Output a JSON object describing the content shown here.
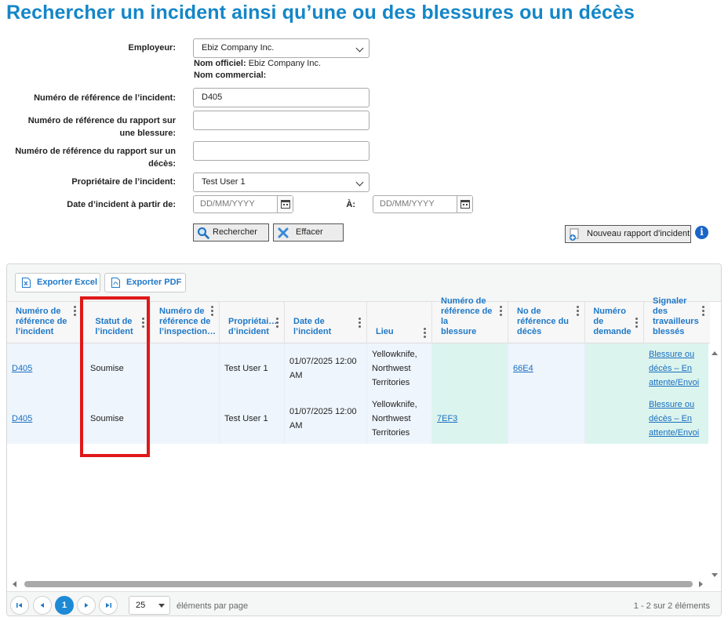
{
  "page": {
    "title": "Rechercher un incident ainsi qu’une ou des blessures ou un décès"
  },
  "form": {
    "employer": {
      "label": "Employeur:",
      "value": "Ebiz Company Inc.",
      "official_name_label": "Nom officiel:",
      "official_name": "Ebiz Company Inc.",
      "commercial_name_label": "Nom commercial:"
    },
    "incident_ref": {
      "label": "Numéro de référence de l’incident:",
      "value": "D405"
    },
    "injury_report_ref": {
      "label_line1": "Numéro de référence du rapport sur",
      "label_line2": "une blessure:",
      "value": ""
    },
    "death_report_ref": {
      "label_line1": "Numéro de référence du rapport sur un",
      "label_line2": "décès:",
      "value": ""
    },
    "owner": {
      "label": "Propriétaire de l’incident:",
      "value": "Test User 1"
    },
    "date_from": {
      "label": "Date d’incident à partir de:",
      "placeholder": "DD/MM/YYYY"
    },
    "date_to": {
      "label": "À:",
      "placeholder": "DD/MM/YYYY"
    },
    "search_label": "Rechercher",
    "clear_label": "Effacer",
    "new_report_label": "Nouveau rapport d'incident",
    "info_glyph": "i"
  },
  "grid": {
    "export_excel": "Exporter Excel",
    "export_pdf": "Exporter PDF",
    "columns": [
      [
        "Numéro de",
        "référence de",
        "l’incident"
      ],
      [
        "Statut de",
        "l’incident"
      ],
      [
        "Numéro de",
        "référence de",
        "l’inspection…"
      ],
      [
        "Propriétai…",
        "d’incident"
      ],
      [
        "Date de",
        "l’incident"
      ],
      [
        "Lieu"
      ],
      [
        "Numéro de",
        "référence de la",
        "blessure"
      ],
      [
        "No de",
        "référence du",
        "décès"
      ],
      [
        "Numéro de",
        "demande"
      ],
      [
        "Signaler des",
        "travailleurs",
        "blessés"
      ]
    ],
    "rows": [
      {
        "incident_ref": "D405",
        "status": "Soumise",
        "inspection_ref": "",
        "owner": "Test User 1",
        "date": [
          "01/07/2025 12:00",
          "AM"
        ],
        "location": [
          "Yellowknife,",
          "Northwest",
          "Territories"
        ],
        "injury_ref": "",
        "death_ref": "66E4",
        "request_no": "",
        "report": [
          "Blessure ou",
          "décès – En",
          "attente/Envoi"
        ]
      },
      {
        "incident_ref": "D405",
        "status": "Soumise",
        "inspection_ref": "",
        "owner": "Test User 1",
        "date": [
          "01/07/2025 12:00",
          "AM"
        ],
        "location": [
          "Yellowknife,",
          "Northwest",
          "Territories"
        ],
        "injury_ref": "7EF3",
        "death_ref": "",
        "request_no": "",
        "report": [
          "Blessure ou",
          "décès – En",
          "attente/Envoi"
        ]
      }
    ],
    "pager": {
      "current_page": "1",
      "page_size": "25",
      "page_size_label": "éléments par page",
      "summary": "1 - 2 sur 2 éléments"
    }
  },
  "colors": {
    "title_blue": "#1486c8",
    "link_blue": "#1a6fc0",
    "row_bg": "#eef5fc",
    "highlight_bg": "#dcf4ee",
    "annotation_red": "#e01818"
  }
}
